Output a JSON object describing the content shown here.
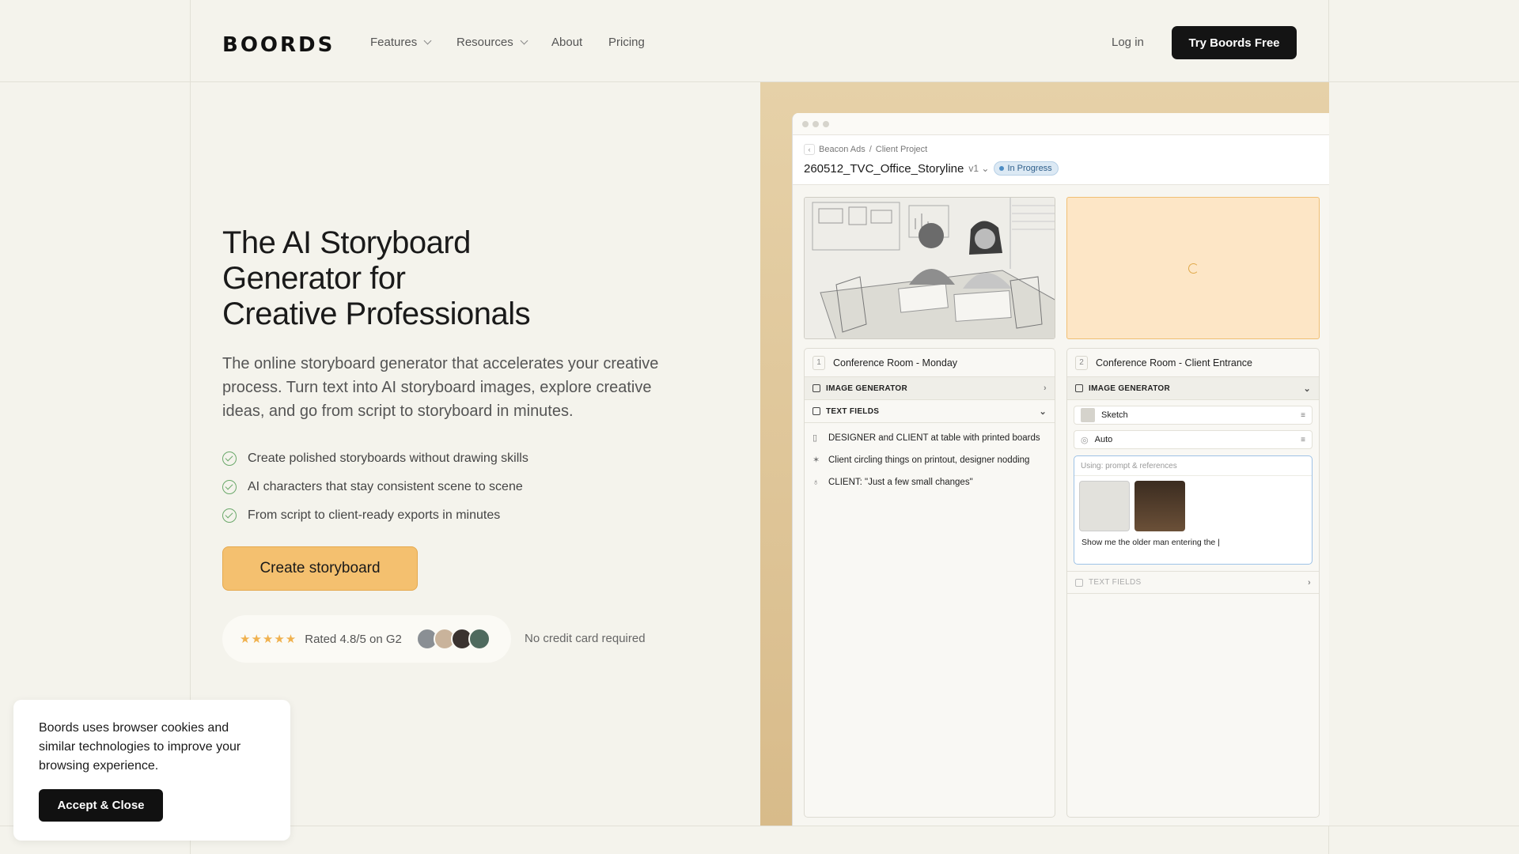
{
  "header": {
    "logo": "BOORDS",
    "nav": [
      {
        "label": "Features",
        "dropdown": true
      },
      {
        "label": "Resources",
        "dropdown": true
      },
      {
        "label": "About",
        "dropdown": false
      },
      {
        "label": "Pricing",
        "dropdown": false
      }
    ],
    "login": "Log in",
    "cta": "Try Boords Free"
  },
  "hero": {
    "title_lines": [
      "The AI Storyboard",
      "Generator for",
      "Creative Professionals"
    ],
    "subtitle": "The online storyboard generator that accelerates your creative process. Turn text into AI storyboard images, explore creative ideas, and go from script to storyboard in minutes.",
    "bullets": [
      "Create polished storyboards without drawing skills",
      "AI characters that stay consistent scene to scene",
      "From script to client-ready exports in minutes"
    ],
    "cta": "Create storyboard",
    "rating": {
      "stars": "★★★★★",
      "text": "Rated 4.8/5 on G2"
    },
    "no_credit": "No credit card required"
  },
  "app": {
    "breadcrumb": [
      "Beacon Ads",
      "/",
      "Client Project"
    ],
    "project_title": "260512_TVC_Office_Storyline",
    "version": "v1",
    "status": "In Progress",
    "frames": [
      {
        "number": "1",
        "title": "Conference Room - Monday",
        "image_generator": "IMAGE GENERATOR",
        "text_fields_label": "TEXT FIELDS",
        "text_fields": [
          {
            "icon": "clipboard-icon",
            "text": "DESIGNER and CLIENT at table with printed boards"
          },
          {
            "icon": "figure-icon",
            "text": "Client circling things on printout, designer nodding"
          },
          {
            "icon": "mic-icon",
            "text": "CLIENT: \"Just a few small changes\""
          }
        ]
      },
      {
        "number": "2",
        "title": "Conference Room - Client Entrance",
        "image_generator": "IMAGE GENERATOR",
        "style": "Sketch",
        "camera": "Auto",
        "prompt_label": "Using: prompt & references",
        "prompt_text": "Show me the older man entering the |",
        "text_fields_label": "TEXT FIELDS"
      }
    ]
  },
  "cookie": {
    "text": "Boords uses browser cookies and similar technologies to improve your browsing experience.",
    "button": "Accept & Close"
  },
  "colors": {
    "accent": "#f4c06f",
    "dark": "#141414",
    "check": "#6aa86a",
    "status": "#4d8dc4"
  }
}
